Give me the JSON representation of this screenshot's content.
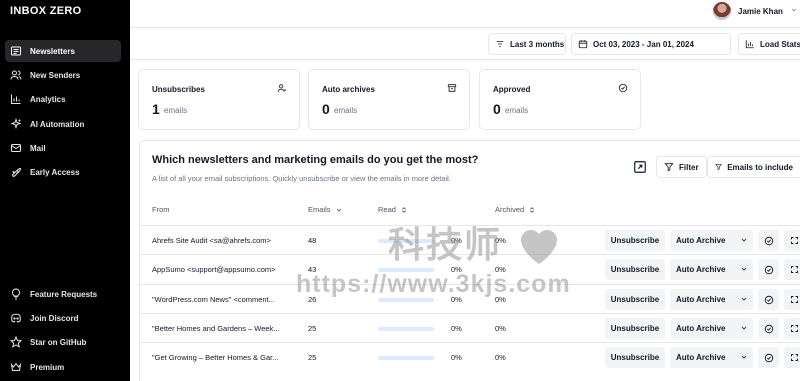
{
  "app": {
    "logo": "INBOX ZERO"
  },
  "sidebar": {
    "items": [
      {
        "label": "Newsletters",
        "icon": "newsletter-icon",
        "active": true
      },
      {
        "label": "New Senders",
        "icon": "users-icon"
      },
      {
        "label": "Analytics",
        "icon": "bar-chart-icon"
      },
      {
        "label": "AI Automation",
        "icon": "sparkles-icon"
      },
      {
        "label": "Mail",
        "icon": "mail-icon"
      },
      {
        "label": "Early Access",
        "icon": "rocket-icon"
      }
    ],
    "bottom_items": [
      {
        "label": "Feature Requests",
        "icon": "lightbulb-icon"
      },
      {
        "label": "Join Discord",
        "icon": "discord-icon"
      },
      {
        "label": "Star on GitHub",
        "icon": "star-icon"
      },
      {
        "label": "Premium",
        "icon": "crown-icon"
      }
    ]
  },
  "header": {
    "user_name": "Jamie Khan"
  },
  "filters": {
    "period": "Last 3 months",
    "date_range": "Oct 03, 2023 - Jan 01, 2024",
    "load_stats": "Load Stats"
  },
  "stats": [
    {
      "title": "Unsubscribes",
      "value": "1",
      "unit": "emails",
      "icon": "user-minus-icon"
    },
    {
      "title": "Auto archives",
      "value": "0",
      "unit": "emails",
      "icon": "archive-icon"
    },
    {
      "title": "Approved",
      "value": "0",
      "unit": "emails",
      "icon": "check-circle-icon"
    }
  ],
  "table": {
    "title": "Which newsletters and marketing emails do you get the most?",
    "description": "A list of all your email subscriptions. Quickly unsubscribe or view the emails in more detail.",
    "filter_label": "Filter",
    "include_label": "Emails to include",
    "columns": {
      "from": "From",
      "emails": "Emails",
      "read": "Read",
      "archived": "Archived"
    },
    "unsubscribe_label": "Unsubscribe",
    "auto_archive_label": "Auto Archive",
    "rows": [
      {
        "from": "Ahrefs Site Audit <sa@ahrefs.com>",
        "emails": "48",
        "read": "0%",
        "read_fraction": 0,
        "archived": "0%"
      },
      {
        "from": "AppSumo <support@appsumo.com>",
        "emails": "43",
        "read": "0%",
        "read_fraction": 0,
        "archived": "0%"
      },
      {
        "from": "\"WordPress.com News\" <comment...",
        "emails": "26",
        "read": "0%",
        "read_fraction": 0,
        "archived": "0%"
      },
      {
        "from": "\"Better Homes and Gardens – Week...",
        "emails": "25",
        "read": "0%",
        "read_fraction": 0,
        "archived": "0%"
      },
      {
        "from": "\"Get Growing – Better Homes & Gar...",
        "emails": "25",
        "read": "0%",
        "read_fraction": 0,
        "archived": "0%"
      }
    ]
  },
  "watermark": {
    "cn": "科技师",
    "url": "https://www.3kjs.com"
  }
}
